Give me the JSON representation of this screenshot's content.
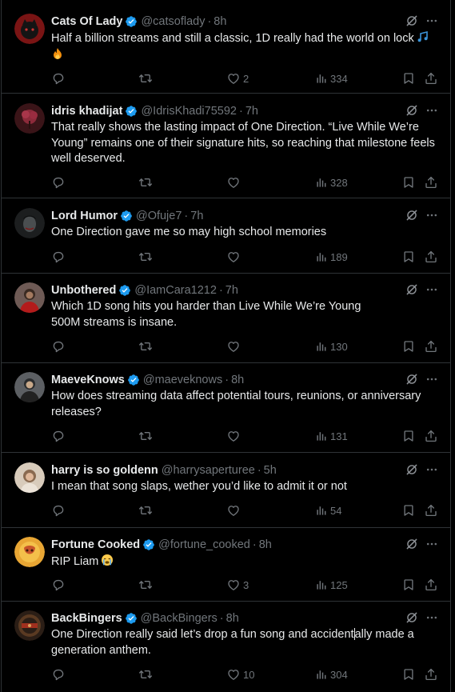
{
  "posts": [
    {
      "name": "Cats Of Lady",
      "handle": "@catsoflady",
      "time": "8h",
      "text": "Half a billion streams and still a classic, 1D really had the world on lock",
      "emoji_names": [
        "music-notes-emoji",
        "fire-emoji"
      ],
      "likes": "2",
      "views": "334",
      "avatar_color": "#7a1414"
    },
    {
      "name": "idris khadijat",
      "handle": "@IdrisKhadi75592",
      "time": "7h",
      "text": "That really shows the lasting impact of One Direction. “Live While We’re Young” remains one of their signature hits, so reaching that milestone feels well deserved.",
      "likes": "",
      "views": "328",
      "avatar_color": "#5a1a22"
    },
    {
      "name": "Lord Humor",
      "handle": "@Ofuje7",
      "time": "7h",
      "text": "One Direction gave me so may high school memories",
      "likes": "",
      "views": "189",
      "avatar_color": "#2a2d2e"
    },
    {
      "name": "Unbothered",
      "handle": "@IamCara1212",
      "time": "7h",
      "text_lines": [
        "Which 1D song hits you harder than Live While We’re Young",
        "500M streams is insane."
      ],
      "likes": "",
      "views": "130",
      "avatar_color": "#8a6f66"
    },
    {
      "name": "MaeveKnows",
      "handle": "@maeveknows",
      "time": "8h",
      "text": "How does streaming data affect potential tours, reunions, or anniversary releases?",
      "likes": "",
      "views": "131",
      "avatar_color": "#6b6d73"
    },
    {
      "name": "harry is so goldenn",
      "handle": "@harrysaperturee",
      "time": "5h",
      "text": "I mean that song slaps, wether you’d like to admit it or not",
      "likes": "",
      "views": "54",
      "avatar_color": "#c9b8a4"
    },
    {
      "name": "Fortune Cooked",
      "handle": "@fortune_cooked",
      "time": "8h",
      "text": "RIP Liam",
      "emoji_names": [
        "loudly-crying-face-emoji"
      ],
      "likes": "3",
      "views": "125",
      "avatar_color": "#d99a2b"
    },
    {
      "name": "BackBingers",
      "handle": "@BackBingers",
      "time": "8h",
      "text_before_caret": "One Direction really said let’s drop a fun song and accident",
      "text_after_caret": "ally made a generation anthem.",
      "likes": "10",
      "views": "304",
      "avatar_color": "#3b2a1f"
    }
  ],
  "icons": {
    "verified": "verified-badge-icon",
    "grok": "grok-icon",
    "more": "more-icon",
    "reply": "reply-icon",
    "repost": "repost-icon",
    "like": "heart-icon",
    "views": "views-icon",
    "bookmark": "bookmark-icon",
    "share": "share-icon"
  },
  "colors": {
    "background": "#000000",
    "text": "#e7e9ea",
    "muted": "#71767b",
    "verified": "#1d9bf0",
    "divider": "#2f3336"
  }
}
